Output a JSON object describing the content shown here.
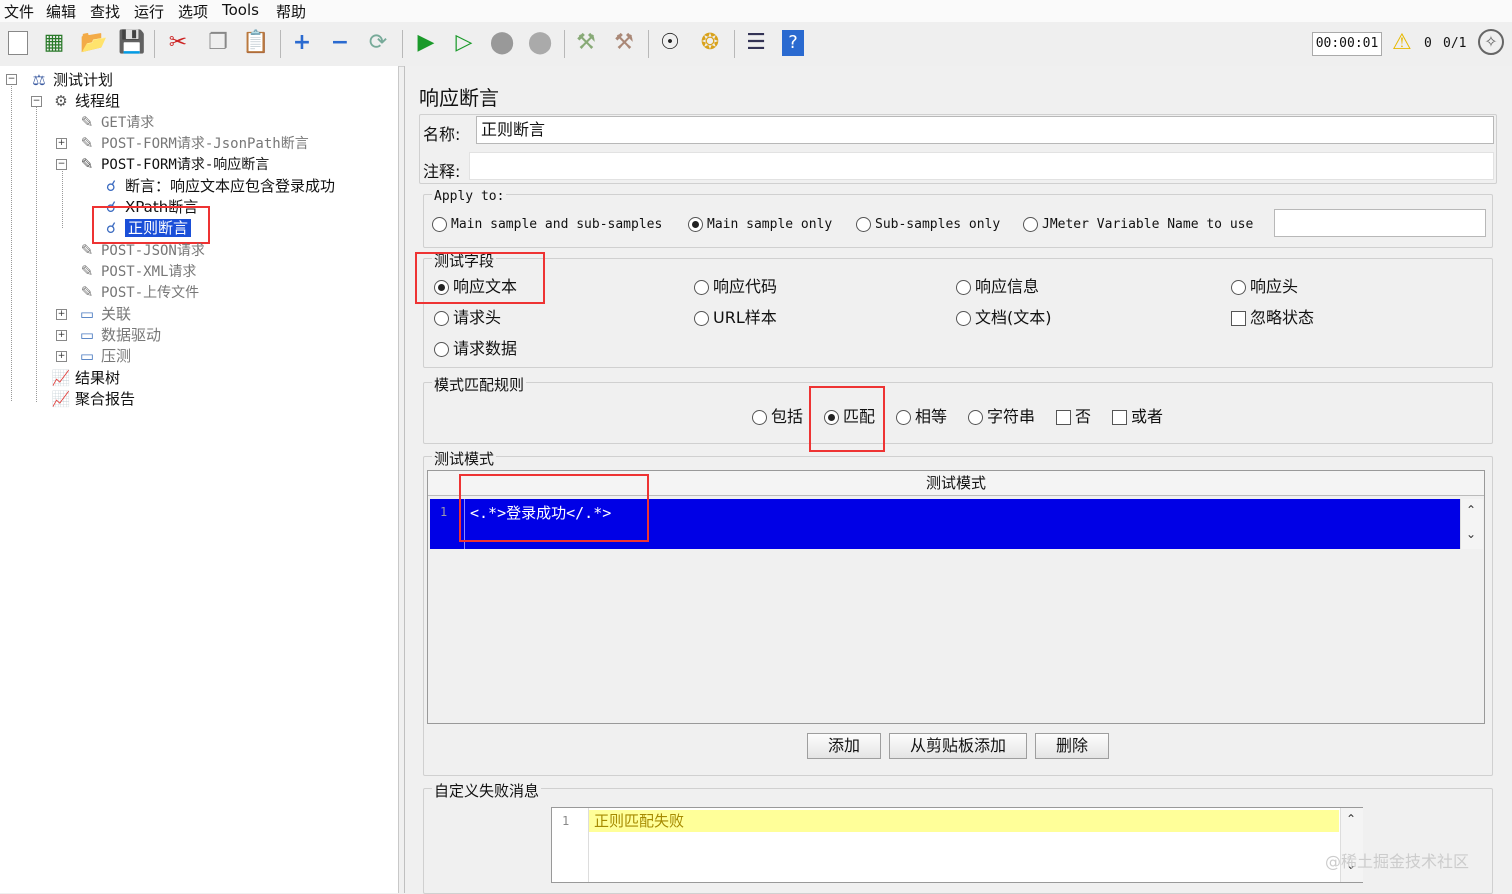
{
  "menu": [
    "文件",
    "编辑",
    "查找",
    "运行",
    "选项",
    "Tools",
    "帮助"
  ],
  "toolbar": {
    "timer": "00:00:01",
    "warn_count": "0",
    "threads": "0/1",
    "icons": [
      "new-icon",
      "templates-icon",
      "open-icon",
      "save-icon",
      "cut-icon",
      "copy-icon",
      "paste-icon",
      "expand-icon",
      "collapse-icon",
      "toggle-icon",
      "start-icon",
      "start-no-pause-icon",
      "stop-icon",
      "shutdown-icon",
      "clear-icon",
      "clear-all-icon",
      "search-icon",
      "reset-search-icon",
      "function-helper-icon",
      "help-icon"
    ]
  },
  "tree": {
    "items": [
      {
        "label": "测试计划"
      },
      {
        "label": "线程组"
      },
      {
        "label": "GET请求"
      },
      {
        "label": "POST-FORM请求-JsonPath断言"
      },
      {
        "label": "POST-FORM请求-响应断言"
      },
      {
        "label": "断言：响应文本应包含登录成功"
      },
      {
        "label": "XPath断言"
      },
      {
        "label": "正则断言"
      },
      {
        "label": "POST-JSON请求"
      },
      {
        "label": "POST-XML请求"
      },
      {
        "label": "POST-上传文件"
      },
      {
        "label": "关联"
      },
      {
        "label": "数据驱动"
      },
      {
        "label": "压测"
      },
      {
        "label": "结果树"
      },
      {
        "label": "聚合报告"
      }
    ]
  },
  "panel": {
    "title": "响应断言",
    "name_label": "名称:",
    "name_value": "正则断言",
    "comment_label": "注释:",
    "comment_value": "",
    "apply_to": {
      "legend": "Apply to:",
      "options": [
        "Main sample and sub-samples",
        "Main sample only",
        "Sub-samples only",
        "JMeter Variable Name to use"
      ],
      "selected": "Main sample only",
      "variable_value": ""
    },
    "field_to_test": {
      "legend": "测试字段",
      "options": [
        "响应文本",
        "响应代码",
        "响应信息",
        "响应头",
        "请求头",
        "URL样本",
        "文档(文本)",
        "忽略状态",
        "请求数据"
      ],
      "selected": "响应文本"
    },
    "pattern_rules": {
      "legend": "模式匹配规则",
      "options": [
        "包括",
        "匹配",
        "相等",
        "字符串",
        "否",
        "或者"
      ],
      "selected": "匹配"
    },
    "patterns": {
      "legend": "测试模式",
      "column_header": "测试模式",
      "rows": [
        {
          "line": "1",
          "value": "<.*>登录成功</.*>"
        }
      ]
    },
    "buttons": {
      "add": "添加",
      "add_clipboard": "从剪贴板添加",
      "delete": "删除"
    },
    "failure": {
      "legend": "自定义失败消息",
      "line": "1",
      "value": "正则匹配失败"
    },
    "watermark": "@稀土掘金技术社区"
  }
}
